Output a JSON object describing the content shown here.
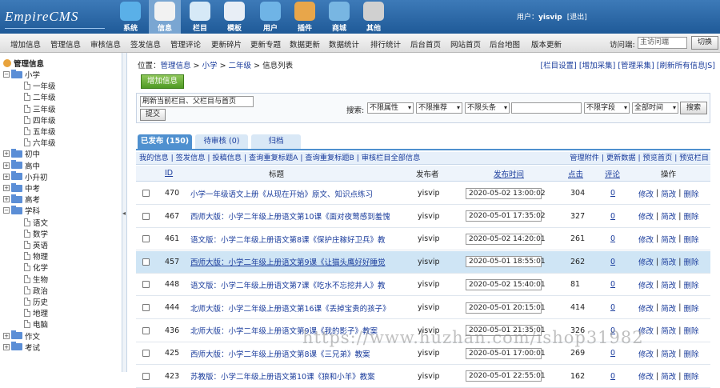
{
  "app": {
    "logo": "EmpireCMS"
  },
  "nav": [
    {
      "label": "系统",
      "icon": "globe-icon",
      "color": "#5ab0e8"
    },
    {
      "label": "信息",
      "icon": "document-edit-icon",
      "color": "#f2f2f2"
    },
    {
      "label": "栏目",
      "icon": "folder-icon",
      "color": "#d6e9f7"
    },
    {
      "label": "模板",
      "icon": "template-icon",
      "color": "#e8eef6"
    },
    {
      "label": "用户",
      "icon": "user-icon",
      "color": "#6fb4e6"
    },
    {
      "label": "插件",
      "icon": "tools-icon",
      "color": "#e8a64a"
    },
    {
      "label": "商城",
      "icon": "shop-card-icon",
      "color": "#78b6e2"
    },
    {
      "label": "其他",
      "icon": "gear-icon",
      "color": "#d0d0d0"
    }
  ],
  "user": {
    "label": "用户：",
    "name": "yisvip",
    "logout": "[退出]"
  },
  "menu": [
    "增加信息",
    "管理信息",
    "审核信息",
    "签发信息",
    "管理评论",
    "更新碎片",
    "更新专题",
    "数据更新",
    "数据统计",
    "排行统计",
    "后台首页",
    "网站首页",
    "后台地图",
    "版本更新"
  ],
  "visit": {
    "label": "访问端:",
    "value": "主访问端",
    "switch": "切换"
  },
  "sidebar": {
    "root": "管理信息",
    "nodes": [
      {
        "label": "小学",
        "type": "folder",
        "level": 1,
        "expanded": true
      },
      {
        "label": "一年级",
        "type": "doc",
        "level": 2
      },
      {
        "label": "二年级",
        "type": "doc",
        "level": 2
      },
      {
        "label": "三年级",
        "type": "doc",
        "level": 2
      },
      {
        "label": "四年级",
        "type": "doc",
        "level": 2
      },
      {
        "label": "五年级",
        "type": "doc",
        "level": 2
      },
      {
        "label": "六年级",
        "type": "doc",
        "level": 2
      },
      {
        "label": "初中",
        "type": "folder",
        "level": 1,
        "expanded": false
      },
      {
        "label": "高中",
        "type": "folder",
        "level": 1,
        "expanded": false
      },
      {
        "label": "小升初",
        "type": "folder",
        "level": 1,
        "expanded": false
      },
      {
        "label": "中考",
        "type": "folder",
        "level": 1,
        "expanded": false
      },
      {
        "label": "高考",
        "type": "folder",
        "level": 1,
        "expanded": false
      },
      {
        "label": "学科",
        "type": "folder",
        "level": 1,
        "expanded": true
      },
      {
        "label": "语文",
        "type": "doc",
        "level": 2
      },
      {
        "label": "数学",
        "type": "doc",
        "level": 2
      },
      {
        "label": "英语",
        "type": "doc",
        "level": 2
      },
      {
        "label": "物理",
        "type": "doc",
        "level": 2
      },
      {
        "label": "化学",
        "type": "doc",
        "level": 2
      },
      {
        "label": "生物",
        "type": "doc",
        "level": 2
      },
      {
        "label": "政治",
        "type": "doc",
        "level": 2
      },
      {
        "label": "历史",
        "type": "doc",
        "level": 2
      },
      {
        "label": "地理",
        "type": "doc",
        "level": 2
      },
      {
        "label": "电脑",
        "type": "doc",
        "level": 2
      },
      {
        "label": "作文",
        "type": "folder",
        "level": 1,
        "expanded": false
      },
      {
        "label": "考试",
        "type": "folder",
        "level": 1,
        "expanded": false
      }
    ]
  },
  "breadcrumb": {
    "prefix": "位置：",
    "items": [
      "管理信息",
      "小学",
      "二年级",
      "信息列表"
    ]
  },
  "top_links": "[栏目设置] [增加采集] [管理采集] [刷新所有信息JS]",
  "add_button": "增加信息",
  "filter": {
    "refresh_select": "刷新当前栏目、父栏目与首页",
    "submit": "提交",
    "search_label": "搜索:",
    "selects": [
      "不限属性",
      "不限推荐",
      "不限头条",
      "不限字段",
      "全部时间"
    ],
    "search_button": "搜索"
  },
  "tabs": [
    {
      "label": "已发布 (150)",
      "active": true
    },
    {
      "label": "待审核 (0)",
      "active": false
    },
    {
      "label": "归档",
      "active": false
    }
  ],
  "linkbar": {
    "left": "我的信息 | 签发信息 | 投稿信息 | 查询重复标题A | 查询重复标题B | 审核栏目全部信息",
    "right": "管理附件 | 更新数据 | 预览首页 | 预览栏目"
  },
  "table": {
    "headers": {
      "id": "ID",
      "title": "标题",
      "publisher": "发布者",
      "time": "发布时间",
      "clicks": "点击",
      "comments": "评论",
      "ops": "操作"
    },
    "rows": [
      {
        "id": "470",
        "title": "小学一年级语文上册《从现在开始》原文、知识点练习",
        "publisher": "yisvip",
        "time": "2020-05-02 13:00:02",
        "clicks": "304",
        "comments": "0"
      },
      {
        "id": "467",
        "title": "西师大版：小学二年级上册语文第10课《面对夜莺感到羞愧",
        "publisher": "yisvip",
        "time": "2020-05-01 17:35:02",
        "clicks": "327",
        "comments": "0"
      },
      {
        "id": "461",
        "title": "语文版：小学二年级上册语文第8课《保护庄稼好卫兵》教",
        "publisher": "yisvip",
        "time": "2020-05-02 14:20:01",
        "clicks": "261",
        "comments": "0"
      },
      {
        "id": "457",
        "title": "西师大版：小学二年级上册语文第9课《让猫头鹰好好睡觉",
        "publisher": "yisvip",
        "time": "2020-05-01 18:55:01",
        "clicks": "262",
        "comments": "0"
      },
      {
        "id": "448",
        "title": "语文版：小学二年级上册语文第7课《吃水不忘挖井人》教",
        "publisher": "yisvip",
        "time": "2020-05-02 15:40:01",
        "clicks": "81",
        "comments": "0"
      },
      {
        "id": "444",
        "title": "北师大版：小学二年级上册语文第16课《丢掉宝贵的孩子》",
        "publisher": "yisvip",
        "time": "2020-05-01 20:15:01",
        "clicks": "414",
        "comments": "0"
      },
      {
        "id": "436",
        "title": "北师大版：小学二年级上册语文第9课《我的影子》教案",
        "publisher": "yisvip",
        "time": "2020-05-01 21:35:01",
        "clicks": "326",
        "comments": "0"
      },
      {
        "id": "425",
        "title": "西师大版：小学二年级上册语文第8课《三兄弟》教案",
        "publisher": "yisvip",
        "time": "2020-05-01 17:00:01",
        "clicks": "269",
        "comments": "0"
      },
      {
        "id": "423",
        "title": "苏教版：小学二年级上册语文第10课《狼和小羊》教案",
        "publisher": "yisvip",
        "time": "2020-05-01 22:55:01",
        "clicks": "162",
        "comments": "0"
      }
    ],
    "highlight_row": 3,
    "ops": {
      "edit": "修改",
      "quick": "简改",
      "delete": "删除"
    }
  },
  "watermark": "https://www.huzhan.com/ishop31982"
}
